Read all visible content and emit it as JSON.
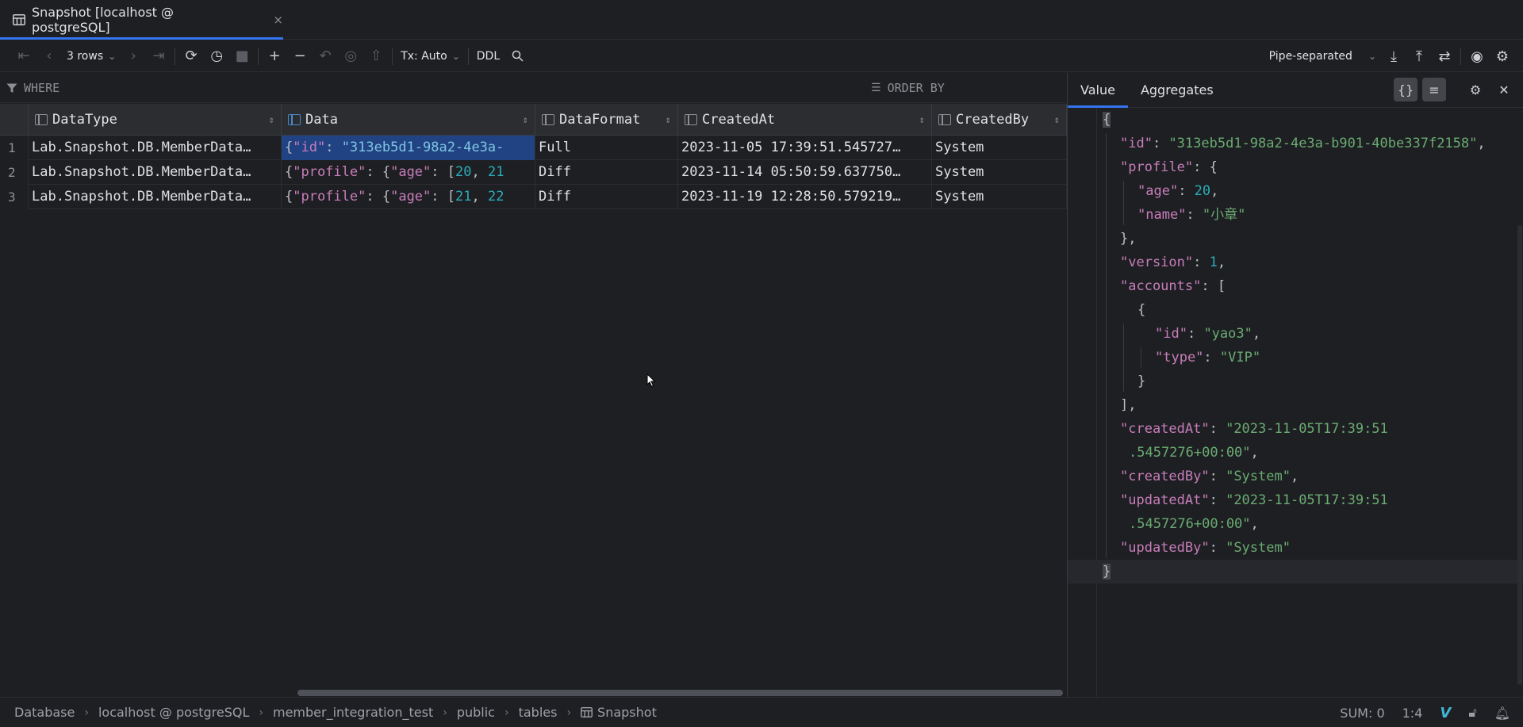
{
  "tab": {
    "title": "Snapshot [localhost @ postgreSQL]",
    "close": "×"
  },
  "toolbar": {
    "rows_label": "3 rows",
    "tx_label": "Tx: Auto",
    "ddl_label": "DDL",
    "format_label": "Pipe-separated"
  },
  "filter": {
    "where": "WHERE",
    "order_by": "ORDER BY"
  },
  "grid": {
    "columns": [
      "DataType",
      "Data",
      "DataFormat",
      "CreatedAt",
      "CreatedBy"
    ],
    "rows": [
      {
        "num": "1",
        "datatype": "Lab.Snapshot.DB.MemberData…",
        "format": "Full",
        "created_at": "2023-11-05 17:39:51.545727…",
        "created_by": "System"
      },
      {
        "num": "2",
        "datatype": "Lab.Snapshot.DB.MemberData…",
        "format": "Diff",
        "created_at": "2023-11-14 05:50:59.637750…",
        "created_by": "System"
      },
      {
        "num": "3",
        "datatype": "Lab.Snapshot.DB.MemberData…",
        "format": "Diff",
        "created_at": "2023-11-19 12:28:50.579219…",
        "created_by": "System"
      }
    ],
    "data_cells": [
      {
        "p1": "{",
        "k1": "\"id\"",
        "p2": ": ",
        "v1": "\"313eb5d1-98a2-4e3a-"
      },
      {
        "p1": "{",
        "k1": "\"profile\"",
        "p2": ": {",
        "k2": "\"age\"",
        "p3": ": [",
        "n1": "20",
        "p4": ", ",
        "n2": "21"
      },
      {
        "p1": "{",
        "k1": "\"profile\"",
        "p2": ": {",
        "k2": "\"age\"",
        "p3": ": [",
        "n1": "21",
        "p4": ", ",
        "n2": "22"
      }
    ]
  },
  "panel": {
    "tabs": [
      "Value",
      "Aggregates"
    ],
    "lines": [
      {
        "i": 0,
        "parts": [
          [
            "p",
            "{"
          ]
        ]
      },
      {
        "i": 1,
        "parts": [
          [
            "k",
            "\"id\""
          ],
          [
            "p",
            ": "
          ],
          [
            "s",
            "\"313eb5d1-98a2-4e3a-b901-40be337f2158\""
          ],
          [
            "p",
            ","
          ]
        ]
      },
      {
        "i": 1,
        "parts": [
          [
            "k",
            "\"profile\""
          ],
          [
            "p",
            ": {"
          ]
        ]
      },
      {
        "i": 2,
        "parts": [
          [
            "k",
            "\"age\""
          ],
          [
            "p",
            ": "
          ],
          [
            "n",
            "20"
          ],
          [
            "p",
            ","
          ]
        ]
      },
      {
        "i": 2,
        "parts": [
          [
            "k",
            "\"name\""
          ],
          [
            "p",
            ": "
          ],
          [
            "s",
            "\"小章\""
          ]
        ]
      },
      {
        "i": 1,
        "parts": [
          [
            "p",
            "},"
          ]
        ]
      },
      {
        "i": 1,
        "parts": [
          [
            "k",
            "\"version\""
          ],
          [
            "p",
            ": "
          ],
          [
            "n",
            "1"
          ],
          [
            "p",
            ","
          ]
        ]
      },
      {
        "i": 1,
        "parts": [
          [
            "k",
            "\"accounts\""
          ],
          [
            "p",
            ": ["
          ]
        ]
      },
      {
        "i": 2,
        "parts": [
          [
            "p",
            "{"
          ]
        ]
      },
      {
        "i": 3,
        "parts": [
          [
            "k",
            "\"id\""
          ],
          [
            "p",
            ": "
          ],
          [
            "s",
            "\"yao3\""
          ],
          [
            "p",
            ","
          ]
        ]
      },
      {
        "i": 3,
        "parts": [
          [
            "k",
            "\"type\""
          ],
          [
            "p",
            ": "
          ],
          [
            "s",
            "\"VIP\""
          ]
        ]
      },
      {
        "i": 2,
        "parts": [
          [
            "p",
            "}"
          ]
        ]
      },
      {
        "i": 1,
        "parts": [
          [
            "p",
            "],"
          ]
        ]
      },
      {
        "i": 1,
        "parts": [
          [
            "k",
            "\"createdAt\""
          ],
          [
            "p",
            ": "
          ],
          [
            "s",
            "\"2023-11-05T17:39:51"
          ]
        ]
      },
      {
        "i": 1.5,
        "parts": [
          [
            "s",
            ".5457276+00:00\""
          ],
          [
            "p",
            ","
          ]
        ]
      },
      {
        "i": 1,
        "parts": [
          [
            "k",
            "\"createdBy\""
          ],
          [
            "p",
            ": "
          ],
          [
            "s",
            "\"System\""
          ],
          [
            "p",
            ","
          ]
        ]
      },
      {
        "i": 1,
        "parts": [
          [
            "k",
            "\"updatedAt\""
          ],
          [
            "p",
            ": "
          ],
          [
            "s",
            "\"2023-11-05T17:39:51"
          ]
        ]
      },
      {
        "i": 1.5,
        "parts": [
          [
            "s",
            ".5457276+00:00\""
          ],
          [
            "p",
            ","
          ]
        ]
      },
      {
        "i": 1,
        "parts": [
          [
            "k",
            "\"updatedBy\""
          ],
          [
            "p",
            ": "
          ],
          [
            "s",
            "\"System\""
          ]
        ]
      },
      {
        "i": 0,
        "parts": [
          [
            "p",
            "}"
          ]
        ]
      }
    ]
  },
  "status": {
    "breadcrumbs": [
      "Database",
      "localhost @ postgreSQL",
      "member_integration_test",
      "public",
      "tables",
      "Snapshot"
    ],
    "sum": "SUM: 0",
    "position": "1:4"
  },
  "colors": {
    "accent": "#3574f0",
    "selection": "#214283",
    "json_key": "#c77dbb",
    "json_string": "#6aab73",
    "json_number": "#2aacb8"
  }
}
